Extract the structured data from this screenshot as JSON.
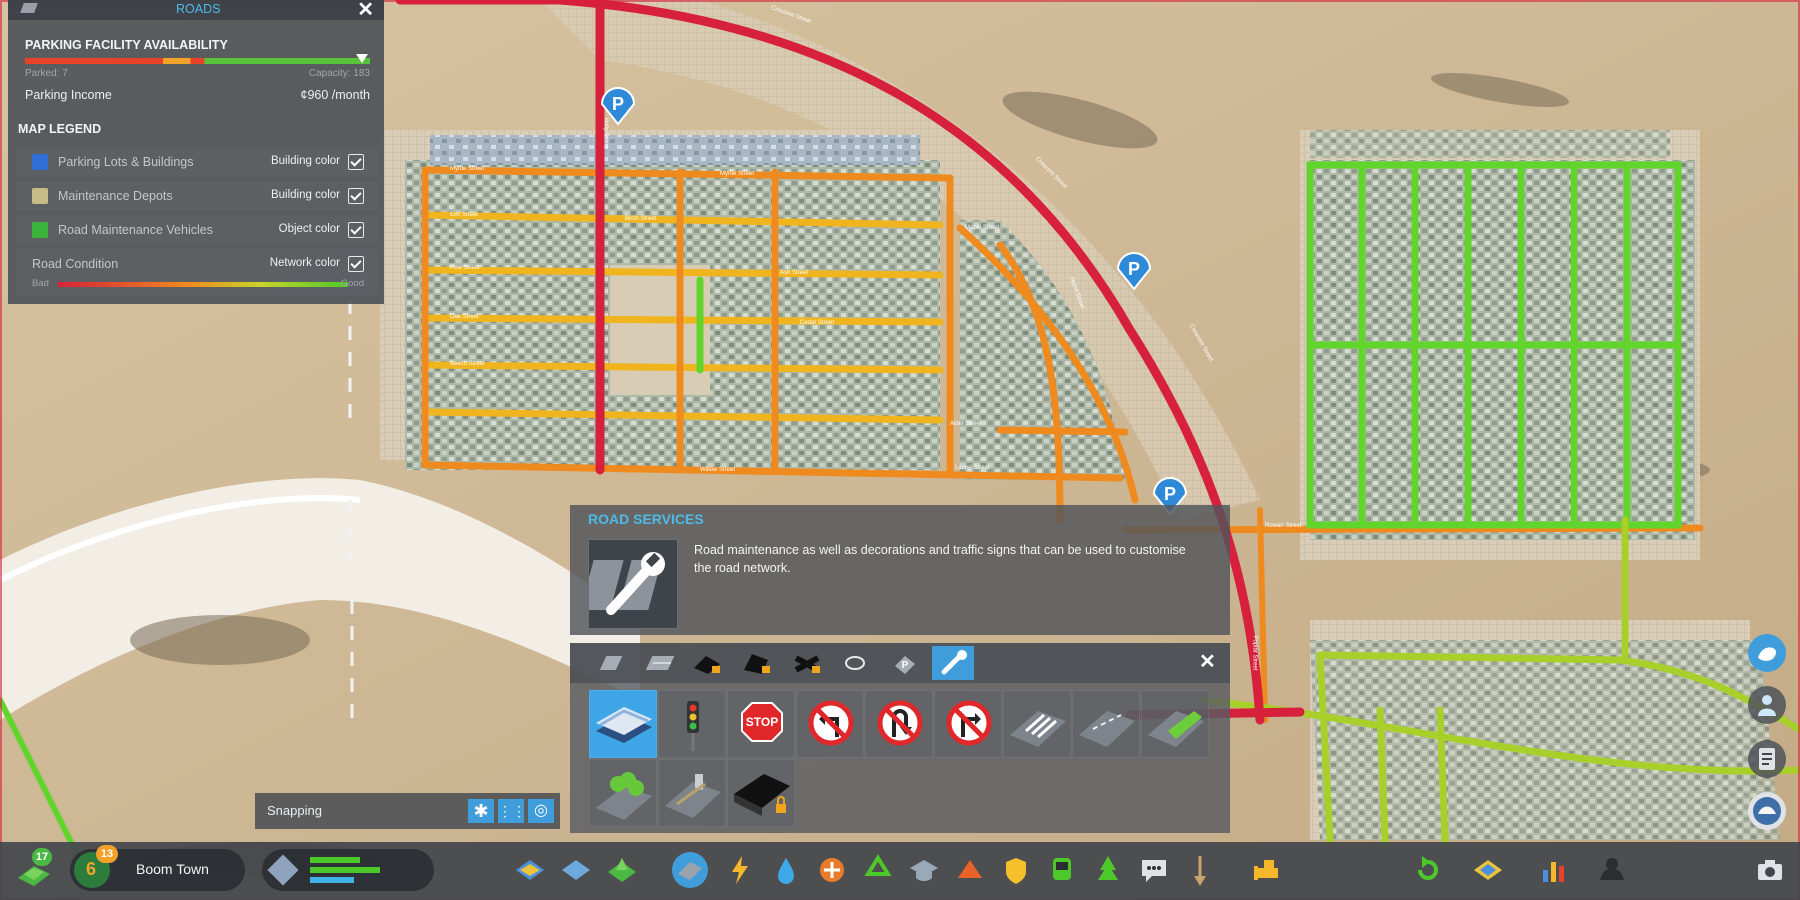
{
  "roads_panel": {
    "title": "ROADS",
    "parking": {
      "heading": "PARKING FACILITY AVAILABILITY",
      "parked_label": "Parked: 7",
      "capacity_label": "Capacity: 183",
      "income_label": "Parking Income",
      "income_value": "¢960 /month"
    },
    "legend": {
      "heading": "MAP LEGEND",
      "items": [
        {
          "label": "Parking Lots & Buildings",
          "type": "Building color",
          "color": "#2f6fd6",
          "checked": true
        },
        {
          "label": "Maintenance Depots",
          "type": "Building color",
          "color": "#c8bd86",
          "checked": true
        },
        {
          "label": "Road Maintenance Vehicles",
          "type": "Object color",
          "color": "#3cb43c",
          "checked": true
        },
        {
          "label": "Road Condition",
          "type": "Network color",
          "checked": true
        }
      ],
      "scale_bad": "Bad",
      "scale_good": "Good"
    }
  },
  "road_services": {
    "title": "ROAD SERVICES",
    "description": "Road maintenance as well as decorations and traffic signs that can be used to customise the road network.",
    "tab_icons": [
      "small-road-icon",
      "medium-road-icon",
      "highway-locked-icon",
      "highway-ramp-locked-icon",
      "intersection-locked-icon",
      "roundabout-icon",
      "parking-icon",
      "road-services-icon"
    ],
    "tools_row1": [
      "maintenance-depot-icon",
      "traffic-light-icon",
      "stop-sign-icon",
      "no-left-turn-icon",
      "no-u-turn-icon",
      "no-right-turn-icon",
      "crosswalk-icon",
      "road-marking-icon",
      "grass-strip-icon"
    ],
    "tools_row2": [
      "trees-icon",
      "sidewalk-icon",
      "locked-upgrade-icon"
    ]
  },
  "snapping": {
    "label": "Snapping"
  },
  "bottom_bar": {
    "city_name": "Boom Town",
    "level": "6",
    "level_badge": "13",
    "population_badge": "17"
  },
  "street_names": [
    "Crescent Street",
    "Myrtle Street",
    "Maple Street",
    "Holly Street",
    "Elm Street",
    "Birch Street",
    "Pine Street",
    "Ash Street",
    "Oak Street",
    "Cedar Street",
    "Beech Street",
    "Alder Street",
    "Willow Street",
    "Rowan Street",
    "Poplar Street",
    "Laurel Street",
    "Hazel Street",
    "Aspen Street",
    "Spruce Street",
    "Juniper Street",
    "Larch Street",
    "Fir Street",
    "Yew Street",
    "Linden Street"
  ],
  "colors": {
    "accent": "#4fb9e8",
    "panel": "#464a52",
    "bad": "#d8213a",
    "mid": "#f08a1e",
    "good": "#4cc82a"
  }
}
